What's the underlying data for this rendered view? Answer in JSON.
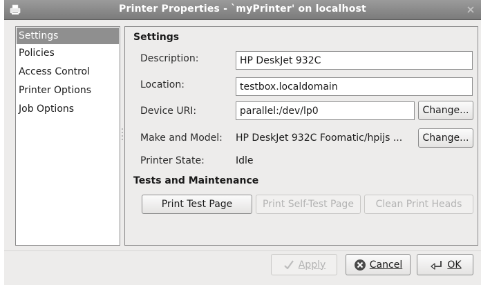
{
  "window": {
    "title": "Printer Properties - `myPrinter' on localhost",
    "icon": "printer-icon"
  },
  "sidebar": {
    "items": [
      {
        "label": "Settings",
        "selected": true
      },
      {
        "label": "Policies",
        "selected": false
      },
      {
        "label": "Access Control",
        "selected": false
      },
      {
        "label": "Printer Options",
        "selected": false
      },
      {
        "label": "Job Options",
        "selected": false
      }
    ]
  },
  "settings": {
    "heading": "Settings",
    "description_label": "Description:",
    "description_value": "HP DeskJet 932C",
    "location_label": "Location:",
    "location_value": "testbox.localdomain",
    "device_uri_label": "Device URI:",
    "device_uri_value": "parallel:/dev/lp0",
    "device_change_label": "Change...",
    "make_model_label": "Make and Model:",
    "make_model_value": "HP DeskJet 932C Foomatic/hpijs ...",
    "make_change_label": "Change...",
    "state_label": "Printer State:",
    "state_value": "Idle"
  },
  "maintenance": {
    "heading": "Tests and Maintenance",
    "print_test_label": "Print Test Page",
    "self_test_label": "Print Self-Test Page",
    "clean_heads_label": "Clean Print Heads"
  },
  "footer": {
    "apply_label": "Apply",
    "cancel_label": "Cancel",
    "ok_label": "OK"
  },
  "colors": {
    "selection": "#8f8f8f",
    "window_bg": "#edeceb",
    "cancel_icon": "#b52a2a"
  }
}
